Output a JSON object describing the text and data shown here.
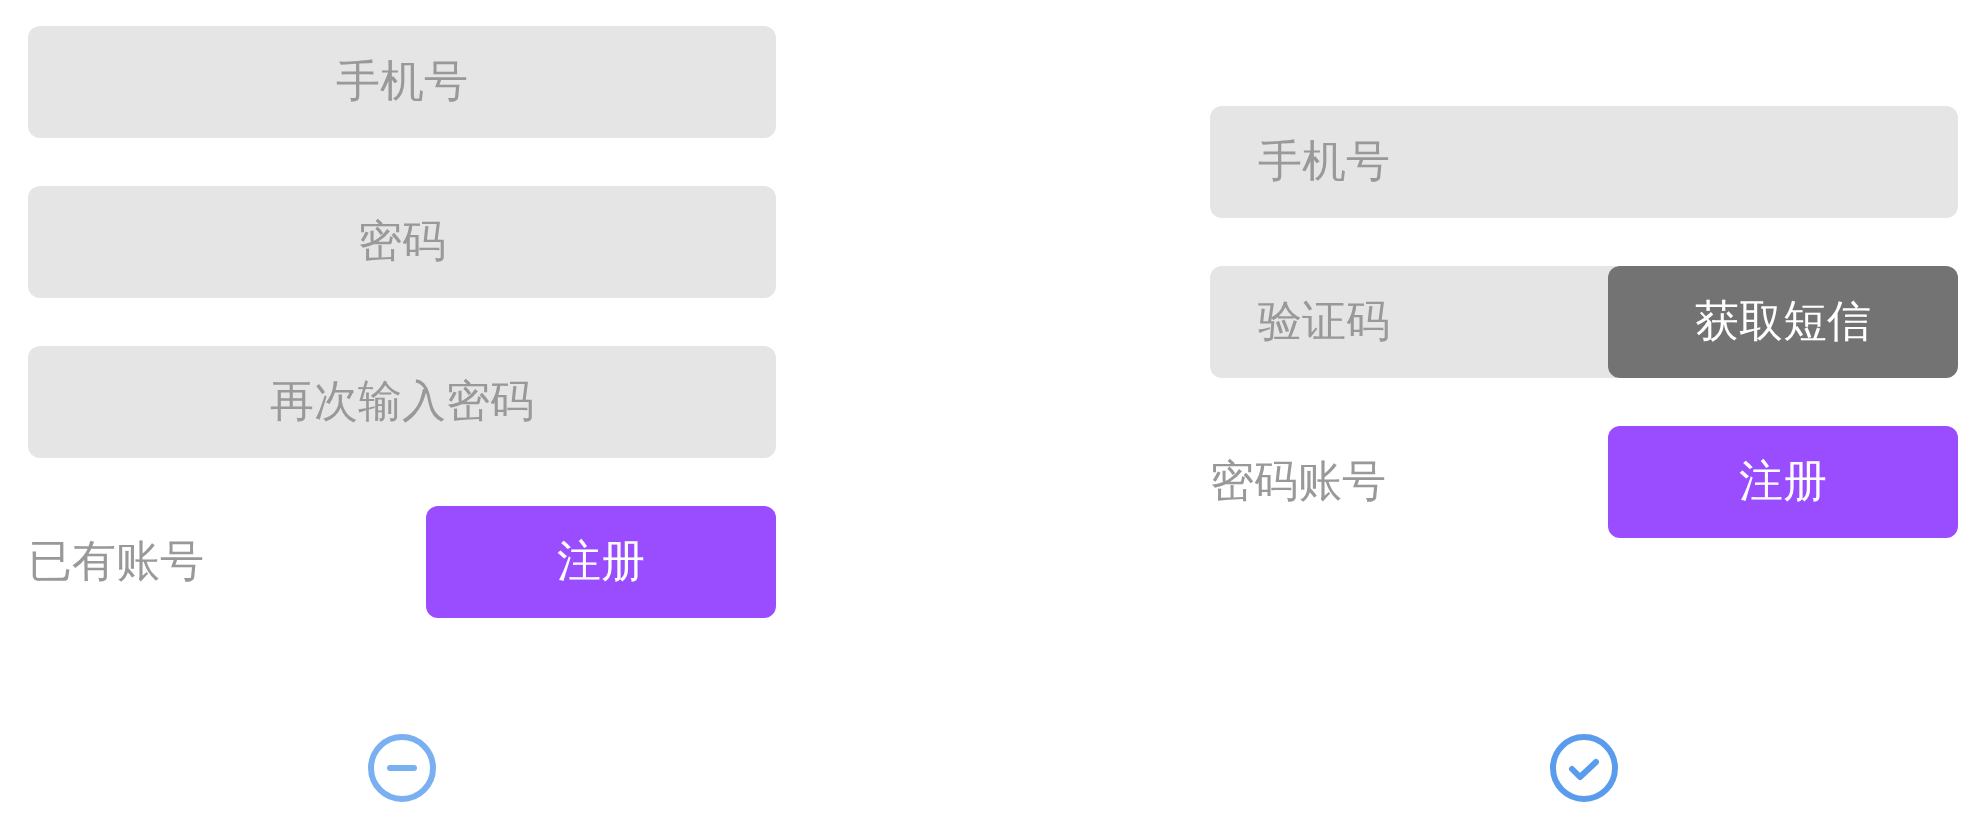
{
  "panels": [
    {
      "fields": [
        {
          "kind": "input",
          "placeholder": "手机号"
        },
        {
          "kind": "input",
          "placeholder": "密码"
        },
        {
          "kind": "input",
          "placeholder": "再次输入密码"
        }
      ],
      "link": "已有账号",
      "button": "注册",
      "selected": false
    },
    {
      "fields": [
        {
          "kind": "input",
          "placeholder": "手机号"
        },
        {
          "kind": "code",
          "placeholder": "验证码",
          "action": "获取短信"
        }
      ],
      "link": "密码账号",
      "button": "注册",
      "selected": true
    }
  ]
}
